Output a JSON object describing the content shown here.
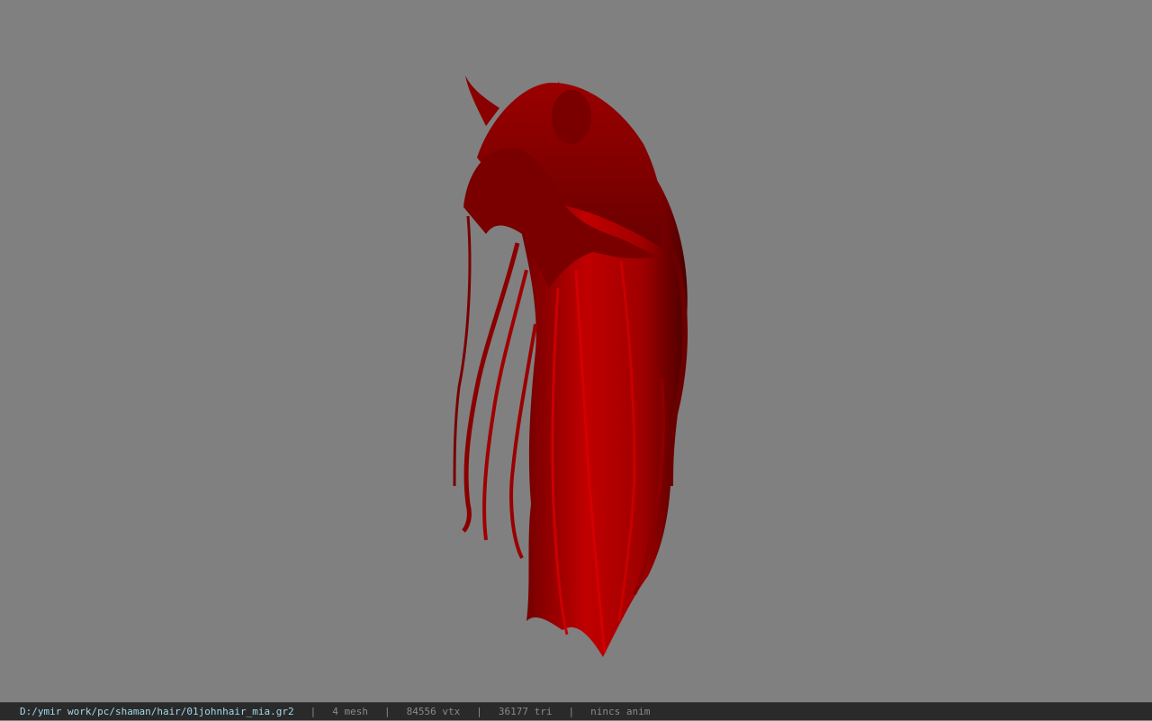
{
  "viewport": {
    "background_color": "#808080",
    "model": {
      "name_icon": "hair-mesh-icon",
      "color": "#b00000"
    }
  },
  "statusbar": {
    "file_path": "D:/ymir work/pc/shaman/hair/01johnhair_mia.gr2",
    "separator": "|",
    "mesh_count": "4 mesh",
    "vertex_count": "84556 vtx",
    "triangle_count": "36177 tri",
    "anim": "nincs anim",
    "path_color": "#9fd8ea",
    "text_color": "#8a8a8a"
  }
}
